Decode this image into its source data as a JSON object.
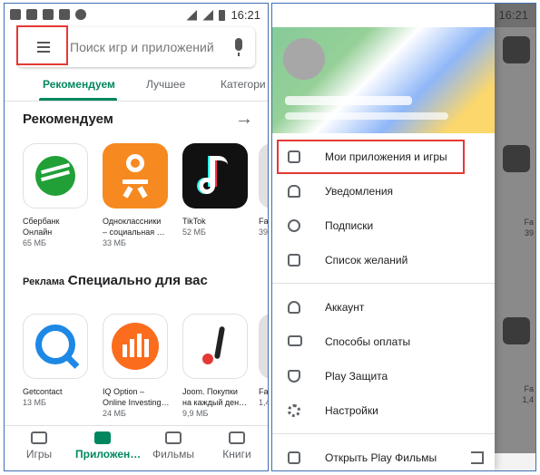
{
  "status": {
    "time": "16:21"
  },
  "left": {
    "search": {
      "placeholder": "Поиск игр и приложений"
    },
    "tabs": [
      "Рекомендуем",
      "Лучшее",
      "Категори"
    ],
    "section1": {
      "title": "Рекомендуем",
      "arrow": "→"
    },
    "recommended": [
      {
        "name": "Сбербанк\nОнлайн",
        "size": "65 МБ",
        "color": "#ffffff"
      },
      {
        "name": "Одноклассники\n– социальная …",
        "size": "33 МБ",
        "color": "#f6891f"
      },
      {
        "name": "TikTok",
        "size": "52 МБ",
        "color": "#111111"
      },
      {
        "name": "Fa",
        "size": "39",
        "color": "#e0e0e0"
      }
    ],
    "section2": {
      "ad": "Реклама ·",
      "title": "Специально для вас"
    },
    "special": [
      {
        "name": "Getcontact",
        "size": "13 МБ",
        "color": "#ffffff"
      },
      {
        "name": "IQ Option –\nOnline Investing…",
        "size": "24 МБ",
        "color": "#ffffff"
      },
      {
        "name": "Joom. Покупки\nна каждый ден…",
        "size": "9,9 МБ",
        "color": "#ffffff"
      },
      {
        "name": "Fa",
        "size": "1,4",
        "color": "#e0e0e0"
      }
    ],
    "nav": [
      {
        "label": "Игры",
        "active": false
      },
      {
        "label": "Приложен…",
        "active": true
      },
      {
        "label": "Фильмы",
        "active": false
      },
      {
        "label": "Книги",
        "active": false
      }
    ]
  },
  "right": {
    "menu": [
      {
        "label": "Мои приложения и игры",
        "icon": "grid-icon"
      },
      {
        "label": "Уведомления",
        "icon": "bell-icon"
      },
      {
        "label": "Подписки",
        "icon": "refresh-icon"
      },
      {
        "label": "Список желаний",
        "icon": "bookmark-plus-icon"
      },
      {
        "label": "Аккаунт",
        "icon": "account-icon"
      },
      {
        "label": "Способы оплаты",
        "icon": "credit-card-icon"
      },
      {
        "label": "Play Защита",
        "icon": "shield-icon"
      },
      {
        "label": "Настройки",
        "icon": "gear-icon"
      },
      {
        "label": "Открыть Play Фильмы",
        "icon": "film-icon"
      }
    ],
    "bg_sizes": [
      "39",
      "1,4"
    ],
    "bg_text": [
      "Fa",
      "Fa"
    ]
  },
  "colors": {
    "accent": "#01875f",
    "highlight": "#e53935"
  }
}
